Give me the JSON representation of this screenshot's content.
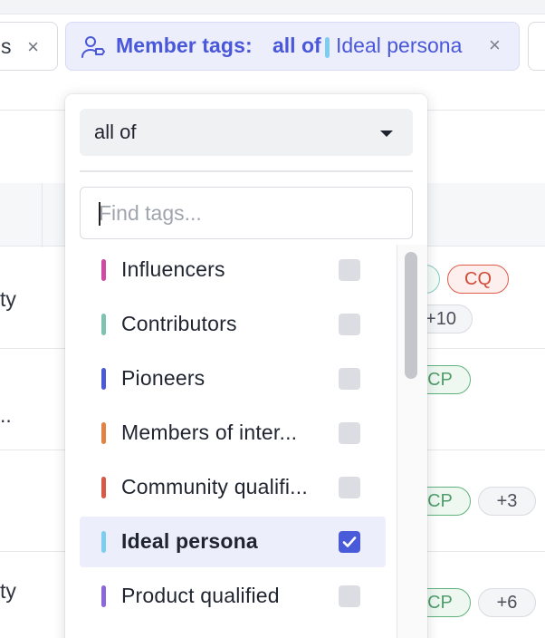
{
  "filters": {
    "left_chip": {
      "text_tail": "s",
      "remove_symbol": "×"
    },
    "member_tags": {
      "label": "Member tags:",
      "operator": "all of",
      "value": "Ideal persona",
      "value_color": "#7dcdf1",
      "remove_symbol": "×",
      "icon": "person-tag-icon"
    }
  },
  "dropdown": {
    "operator_select": {
      "value": "all of"
    },
    "search": {
      "placeholder": "Find tags...",
      "value": ""
    },
    "tags": [
      {
        "name": "Influencers",
        "color": "#cf4aa5",
        "checked": false
      },
      {
        "name": "Contributors",
        "color": "#7ec3b0",
        "checked": false
      },
      {
        "name": "Pioneers",
        "color": "#4a5bd9",
        "checked": false
      },
      {
        "name": "Members of inter...",
        "color": "#e28244",
        "checked": false
      },
      {
        "name": "Community qualifi...",
        "color": "#d85a45",
        "checked": false
      },
      {
        "name": "Ideal persona",
        "color": "#7dcdf1",
        "checked": true
      },
      {
        "name": "Product qualified",
        "color": "#8c67dc",
        "checked": false
      }
    ]
  },
  "table": {
    "rows": [
      {
        "text": "ty",
        "tags": [
          "CQ",
          "+10"
        ]
      },
      {
        "text": "..",
        "tags": [
          "CP"
        ]
      },
      {
        "text": "",
        "tags": [
          "CP",
          "+3"
        ]
      },
      {
        "text": "ty",
        "tags": [
          "CP",
          "+6"
        ]
      }
    ]
  },
  "colors": {
    "accent": "#4a5bd9",
    "chip_bg": "#eceefb",
    "tag_green": "#5fb27c",
    "tag_red": "#dc5b47"
  }
}
